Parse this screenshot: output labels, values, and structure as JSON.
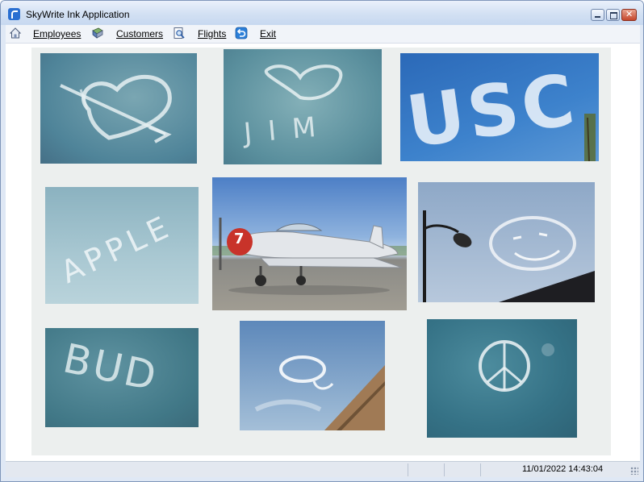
{
  "window": {
    "title": "SkyWrite Ink Application"
  },
  "menu": {
    "items": [
      {
        "label": "Employees",
        "icon": "house-icon"
      },
      {
        "label": "Customers",
        "icon": "book-icon"
      },
      {
        "label": "Flights",
        "icon": "search-document-icon"
      },
      {
        "label": "Exit",
        "icon": "back-arrow-icon"
      }
    ]
  },
  "statusbar": {
    "datetime": "11/01/2022 14:43:04"
  },
  "collage": {
    "photos": [
      {
        "text": ""
      },
      {
        "text": "JIM"
      },
      {
        "text": "USC"
      },
      {
        "text": "APPLE"
      },
      {
        "text": ""
      },
      {
        "text": ""
      },
      {
        "text": "BUD"
      },
      {
        "text": ""
      },
      {
        "text": ""
      }
    ],
    "plane_number": "7"
  },
  "colors": {
    "titlebar": "#d2e0f3",
    "close": "#c4452b",
    "menubar": "#f1f4f9"
  }
}
